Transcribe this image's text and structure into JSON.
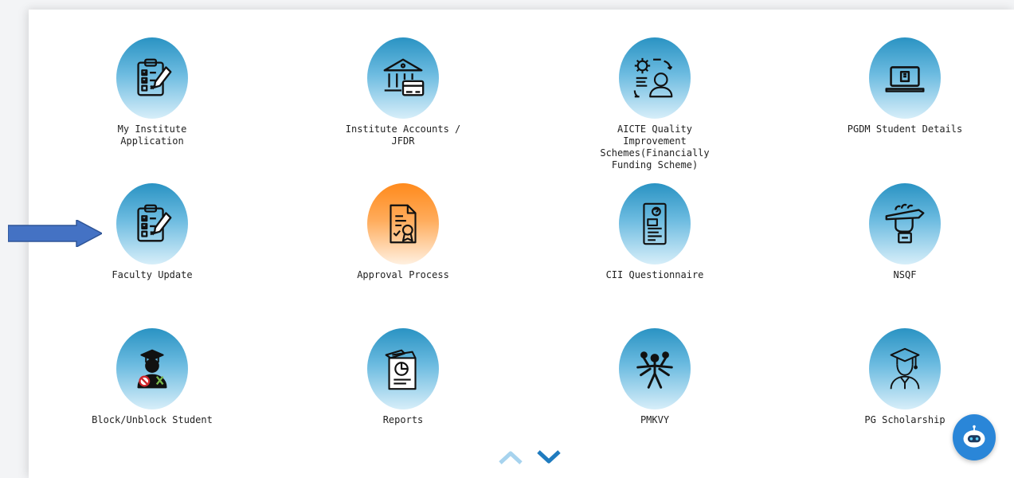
{
  "tiles": [
    {
      "label": "My Institute\nApplication",
      "icon": "clipboard-checklist-icon",
      "color": "blue"
    },
    {
      "label": "Institute Accounts /\nJFDR",
      "icon": "bank-card-icon",
      "color": "blue"
    },
    {
      "label": "AICTE Quality\nImprovement\nSchemes(Financially\nFunding Scheme)",
      "icon": "gear-person-cycle-icon",
      "color": "blue"
    },
    {
      "label": "PGDM Student Details",
      "icon": "laptop-icon",
      "color": "blue"
    },
    {
      "label": "Faculty Update",
      "icon": "clipboard-checklist-icon",
      "color": "blue"
    },
    {
      "label": "Approval Process",
      "icon": "certificate-document-icon",
      "color": "orange"
    },
    {
      "label": "CII Questionnaire",
      "icon": "questionnaire-document-icon",
      "color": "blue"
    },
    {
      "label": "NSQF",
      "icon": "fist-pencil-icon",
      "color": "blue"
    },
    {
      "label": "Block/Unblock Student",
      "icon": "graduate-blocked-icon",
      "color": "blue"
    },
    {
      "label": "Reports",
      "icon": "report-chart-icon",
      "color": "blue"
    },
    {
      "label": "PMKVY",
      "icon": "people-star-icon",
      "color": "blue"
    },
    {
      "label": "PG Scholarship",
      "icon": "graduate-scholar-icon",
      "color": "blue"
    }
  ],
  "colors": {
    "blue_top": "#2a93c3",
    "orange_top": "#ff8a1c",
    "pointer_arrow": "#4472c4",
    "nav_up": "#a7d3ee",
    "nav_down": "#1f7bbf",
    "chatbot": "#2a86d8"
  },
  "pointer": {
    "icon": "right-arrow-icon"
  },
  "nav": {
    "up_icon": "chevron-up-icon",
    "down_icon": "chevron-down-icon"
  },
  "chatbot": {
    "icon": "chatbot-icon"
  }
}
